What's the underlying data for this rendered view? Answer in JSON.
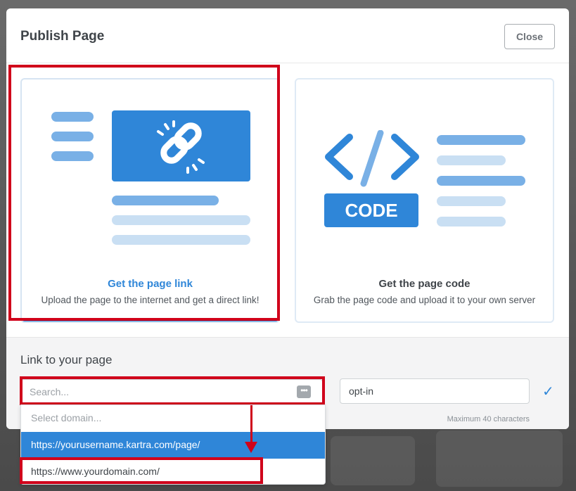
{
  "modal": {
    "title": "Publish Page",
    "close_label": "Close"
  },
  "cards": [
    {
      "title": "Get the page link",
      "description": "Upload the page to the internet and get a direct link!",
      "selected": true
    },
    {
      "title": "Get the page code",
      "description": "Grab the page code and upload it to your own server",
      "code_badge": "CODE",
      "selected": false
    }
  ],
  "link_section": {
    "title": "Link to your page",
    "search_placeholder": "Search...",
    "slug_value": "opt-in",
    "slug_hint": "Maximum 40 characters",
    "dropdown": {
      "placeholder": "Select domain...",
      "options": [
        "https://yourusername.kartra.com/page/",
        "https://www.yourdomain.com/"
      ],
      "selected_index": 0
    }
  },
  "colors": {
    "accent": "#2f86d8",
    "highlight": "#d0021b",
    "icon_light": "#c9dff3",
    "icon_mid": "#79b0e6"
  },
  "icons": {
    "link": "chain-link-icon",
    "code": "code-brackets-icon",
    "more": "ellipsis-icon",
    "check": "checkmark-icon"
  }
}
